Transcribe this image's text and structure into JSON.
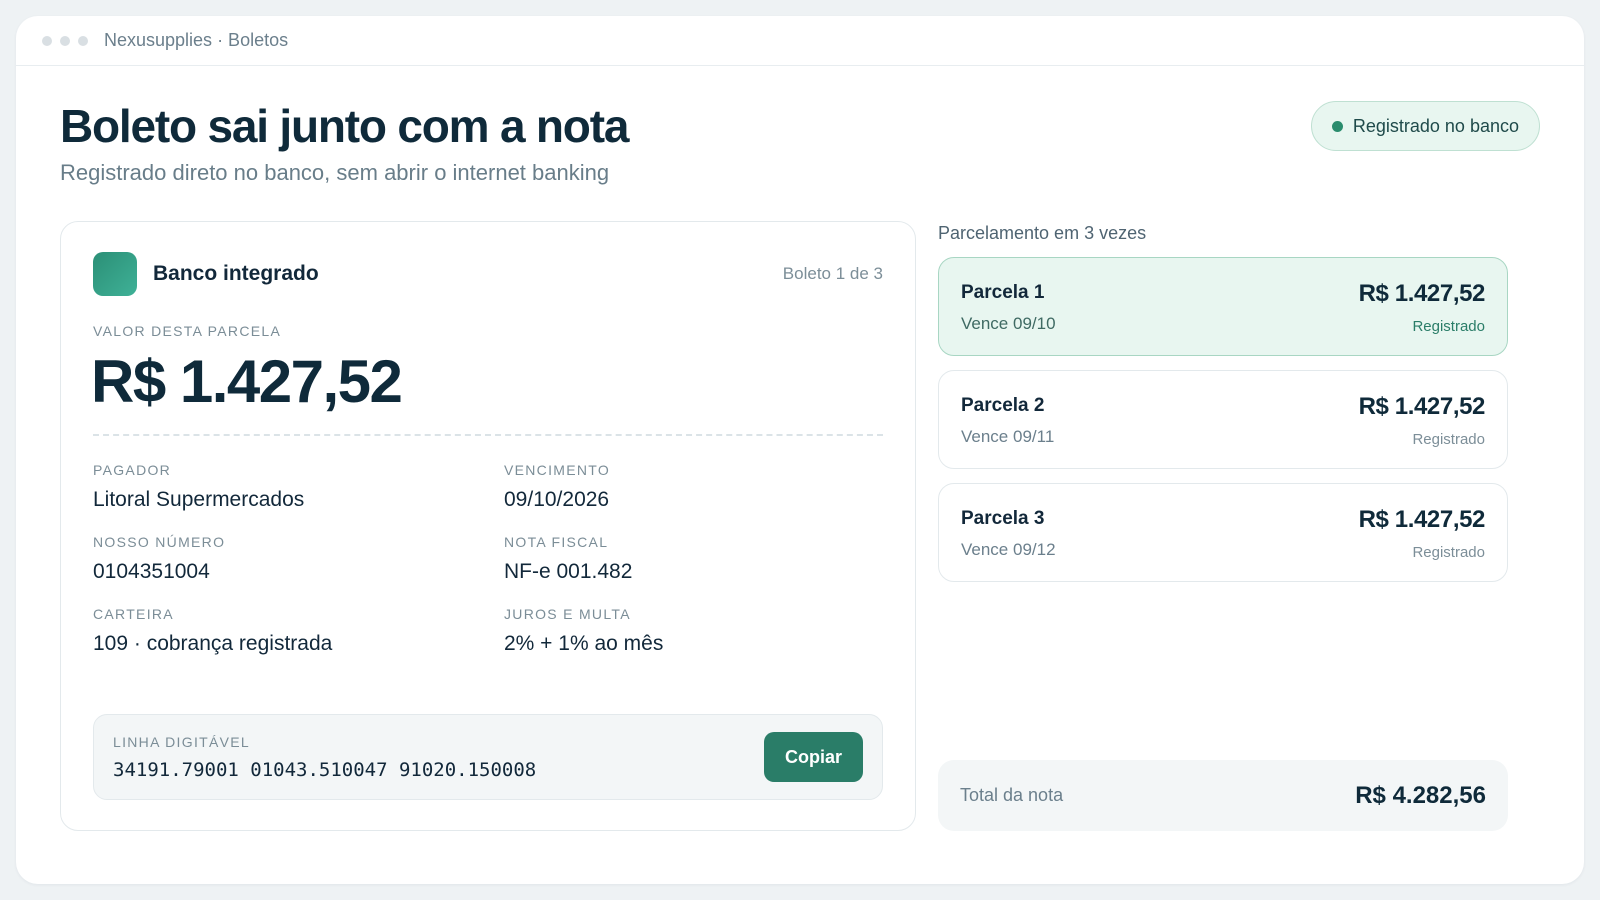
{
  "window": {
    "title": "Nexusupplies · Boletos"
  },
  "header": {
    "title": "Boleto sai junto com a nota",
    "subtitle": "Registrado direto no banco, sem abrir o internet banking",
    "status_badge": "Registrado no banco"
  },
  "boleto": {
    "bank_name": "Banco integrado",
    "counter": "Boleto 1 de 3",
    "amount_label": "VALOR DESTA PARCELA",
    "amount": "R$ 1.427,52",
    "fields": [
      {
        "label": "PAGADOR",
        "value": "Litoral Supermercados"
      },
      {
        "label": "VENCIMENTO",
        "value": "09/10/2026"
      },
      {
        "label": "NOSSO NÚMERO",
        "value": "0104351004"
      },
      {
        "label": "NOTA FISCAL",
        "value": "NF-e 001.482"
      },
      {
        "label": "CARTEIRA",
        "value": "109 · cobrança registrada"
      },
      {
        "label": "JUROS E MULTA",
        "value": "2% + 1% ao mês"
      }
    ],
    "digit_line": {
      "label": "LINHA DIGITÁVEL",
      "value": "34191.79001 01043.510047 91020.150008",
      "copy_label": "Copiar"
    }
  },
  "installments": {
    "title": "Parcelamento em 3 vezes",
    "items": [
      {
        "name": "Parcela 1",
        "due": "Vence 09/10",
        "amount": "R$ 1.427,52",
        "status": "Registrado",
        "active": true
      },
      {
        "name": "Parcela 2",
        "due": "Vence 09/11",
        "amount": "R$ 1.427,52",
        "status": "Registrado",
        "active": false
      },
      {
        "name": "Parcela 3",
        "due": "Vence 09/12",
        "amount": "R$ 1.427,52",
        "status": "Registrado",
        "active": false
      }
    ],
    "total_label": "Total da nota",
    "total_value": "R$ 4.282,56"
  },
  "colors": {
    "accent": "#2a7d68",
    "accent_light": "#e8f6f0",
    "text_primary": "#0f2a3a"
  }
}
